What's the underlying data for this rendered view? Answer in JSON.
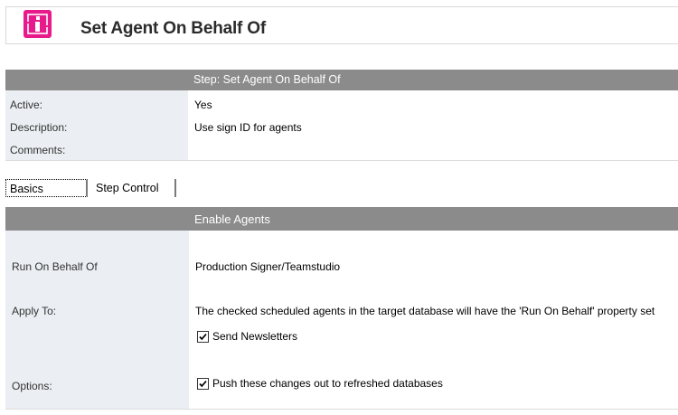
{
  "header": {
    "title": "Set Agent On Behalf Of",
    "icon": "step-info-icon",
    "icon_color": "#e8198b"
  },
  "step": {
    "title": "Step:  Set Agent On Behalf Of",
    "active_label": "Active:",
    "active_value": "Yes",
    "description_label": "Description:",
    "description_value": "Use sign ID for agents",
    "comments_label": "Comments:",
    "comments_value": ""
  },
  "tabs": [
    {
      "label": "Basics",
      "selected": true
    },
    {
      "label": "Step Control",
      "selected": false
    }
  ],
  "section": {
    "title": "Enable Agents",
    "run_on_behalf_label": "Run On Behalf Of",
    "run_on_behalf_value": "Production Signer/Teamstudio",
    "apply_to_label": "Apply To:",
    "apply_to_text": "The checked scheduled agents in the target database will have the 'Run On Behalf' property set",
    "agents": [
      {
        "label": "Send Newsletters",
        "checked": true
      }
    ],
    "options_label": "Options:",
    "options": [
      {
        "label": "Push these changes out to refreshed databases",
        "checked": true
      }
    ]
  },
  "colors": {
    "bar_background": "#8b8b8b",
    "label_column": "#ebeef2",
    "accent": "#e8198b"
  }
}
